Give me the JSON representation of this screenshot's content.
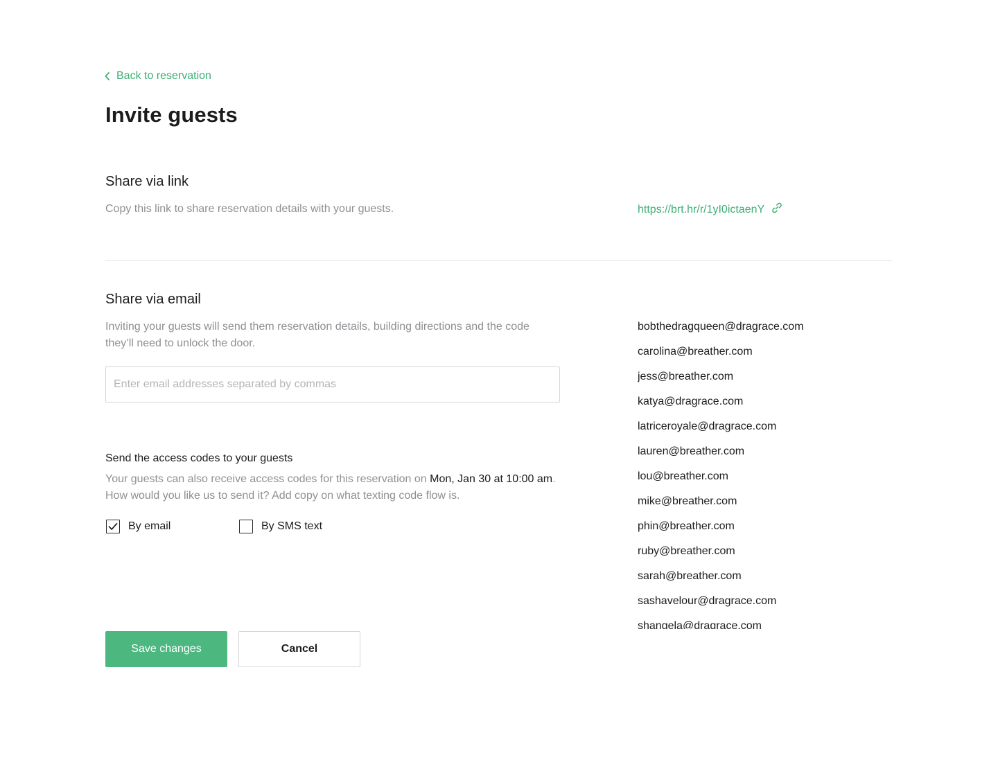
{
  "nav": {
    "back_label": "Back to reservation"
  },
  "page": {
    "title": "Invite guests"
  },
  "link_section": {
    "title": "Share via link",
    "description": "Copy this link to share reservation details with your guests.",
    "url": "https://brt.hr/r/1yI0ictaenY"
  },
  "email_section": {
    "title": "Share via email",
    "description": "Inviting your guests will send them reservation details, building directions and the code they’ll need to unlock the door.",
    "input": {
      "placeholder": "Enter email addresses separated by commas",
      "value": ""
    },
    "guests": [
      "bobthedragqueen@dragrace.com",
      "carolina@breather.com",
      "jess@breather.com",
      "katya@dragrace.com",
      "latriceroyale@dragrace.com",
      "lauren@breather.com",
      "lou@breather.com",
      "mike@breather.com",
      "phin@breather.com",
      "ruby@breather.com",
      "sarah@breather.com",
      "sashavelour@dragrace.com",
      "shangela@dragrace.com"
    ]
  },
  "access_codes": {
    "title": "Send the access codes to your guests",
    "desc_before": "Your guests can also receive access codes for this reservation on ",
    "desc_date": "Mon, Jan 30 at 10:00 am",
    "desc_after": ". How would you like us to send it? Add copy on what texting code flow is.",
    "options": [
      {
        "label": "By email",
        "checked": true
      },
      {
        "label": "By SMS text",
        "checked": false
      }
    ]
  },
  "actions": {
    "save_label": "Save changes",
    "cancel_label": "Cancel"
  },
  "colors": {
    "accent": "#3fae74",
    "primary_button": "#4cb880",
    "muted_text": "#8f8f94",
    "divider": "#e3e3e6"
  },
  "icons": {
    "back": "chevron-left-icon",
    "copy_link": "link-icon",
    "check": "checkmark-icon"
  }
}
